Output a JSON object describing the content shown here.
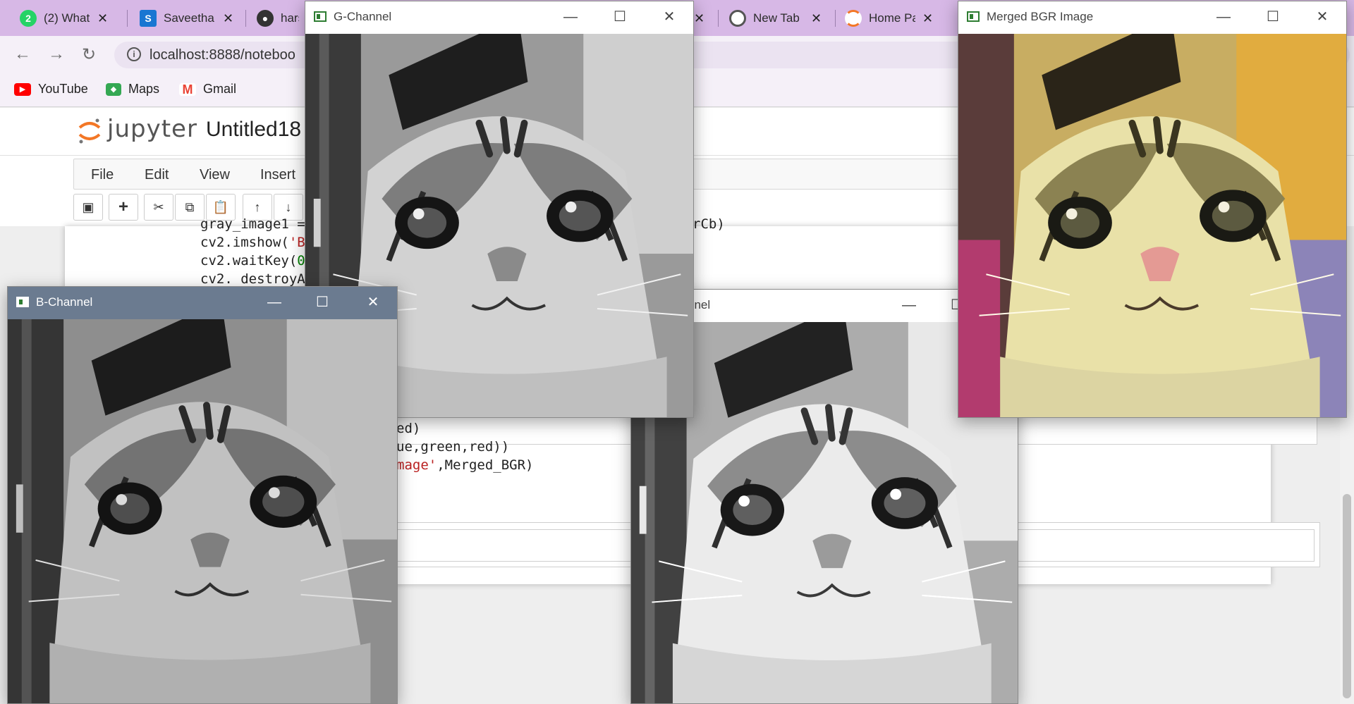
{
  "browser": {
    "tabs": [
      {
        "title": "(2) What",
        "badge": "2",
        "icon": "whatsapp-icon",
        "color": "#25d366"
      },
      {
        "title": "Saveetha",
        "badge": "S",
        "icon": "saveetha-icon",
        "color": "#1976d2"
      },
      {
        "title": "hars",
        "badge": "",
        "icon": "github-icon",
        "color": "#333333"
      },
      {
        "title": "New Tab",
        "badge": "",
        "icon": "chrome-icon",
        "color": "#555555"
      },
      {
        "title": "Home Pa",
        "badge": "",
        "icon": "jupyter-icon",
        "color": "#f37726"
      }
    ],
    "url": "localhost:8888/noteboo",
    "bookmarks": [
      {
        "label": "YouTube",
        "icon": "youtube-icon",
        "color": "#ff0000"
      },
      {
        "label": "Maps",
        "icon": "maps-icon",
        "color": "#34a853"
      },
      {
        "label": "Gmail",
        "icon": "gmail-icon",
        "color": "#ea4335"
      }
    ]
  },
  "jupyter": {
    "wordmark": "jupyter",
    "notebook_title": "Untitled18",
    "menu": [
      "File",
      "Edit",
      "View",
      "Insert"
    ],
    "toolbar": [
      "save-icon",
      "add-cell-icon",
      "cut-icon",
      "copy-icon",
      "paste-icon",
      "move-up-icon",
      "move-down-icon"
    ],
    "code": {
      "line1": "gray_image1 =",
      "line2a": "cv2.imshow(",
      "line2b": "'B",
      "line3a": "cv2.waitKey(",
      "line3b": "0",
      "line4": "cv2. destroyA",
      "frag_right": "rCb)",
      "line5": "ed)",
      "line6": "ue,green,red))",
      "line7a": "mage'",
      "line7b": ",Merged_BGR)"
    }
  },
  "windows": {
    "g_channel": {
      "title": "G-Channel"
    },
    "merged": {
      "title": "Merged BGR Image"
    },
    "b_channel": {
      "title": "B-Channel"
    },
    "r_channel": {
      "title": "nnel"
    },
    "controls": {
      "minimize": "—",
      "maximize": "☐",
      "close": "✕"
    }
  },
  "colors": {
    "tabstrip": "#d7b8e6",
    "active_title": "#6b7b90",
    "code_string": "#ba2121",
    "code_number": "#008000"
  }
}
